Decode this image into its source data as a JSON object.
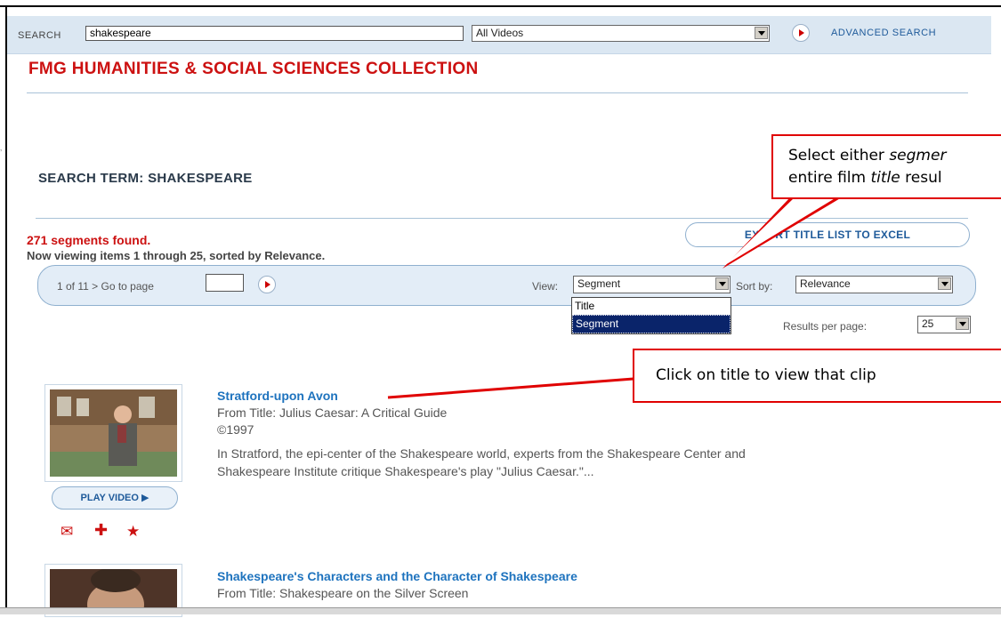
{
  "search": {
    "label": "SEARCH",
    "query": "shakespeare",
    "category": "All Videos",
    "advanced_label": "ADVANCED SEARCH"
  },
  "collection_title": "FMG HUMANITIES & SOCIAL SCIENCES COLLECTION",
  "search_term_heading": "SEARCH TERM: SHAKESPEARE",
  "results_summary": {
    "count_text": "271 segments found.",
    "viewing_text": "Now viewing items 1 through 25, sorted by Relevance."
  },
  "export_button": "EXPORT TITLE LIST TO EXCEL",
  "pager": {
    "text": "1 of 11 > Go to page",
    "view_label": "View:",
    "view_value": "Segment",
    "view_options": [
      "Title",
      "Segment"
    ],
    "sort_label": "Sort by:",
    "sort_value": "Relevance",
    "results_per_page_label": "Results per page:",
    "results_per_page_value": "25"
  },
  "results": [
    {
      "title": "Stratford-upon Avon",
      "from_title": "From Title: Julius Caesar: A Critical Guide",
      "year": "©1997",
      "description": "In Stratford, the epi-center of the Shakespeare world, experts from the Shakespeare Center and Shakespeare Institute critique Shakespeare's play \"Julius Caesar.\"...",
      "play_label": "PLAY VIDEO ▶"
    },
    {
      "title": "Shakespeare's Characters and the Character of Shakespeare",
      "from_title": "From Title: Shakespeare on the Silver Screen"
    }
  ],
  "callouts": {
    "view_callout_line1_pre": "Select either ",
    "view_callout_line1_em": "segmer",
    "view_callout_line2_pre": "entire film ",
    "view_callout_line2_em": "title",
    "view_callout_line2_post": " resul",
    "title_callout": "Click on title to view that clip"
  },
  "colors": {
    "accent_red": "#cc1111",
    "link_blue": "#1e73be",
    "callout_red": "#e00000"
  }
}
